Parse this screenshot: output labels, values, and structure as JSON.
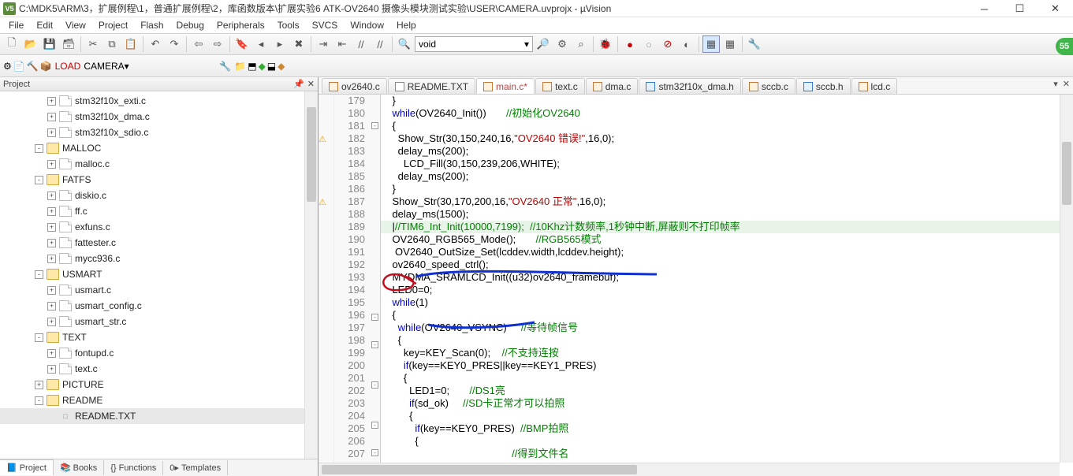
{
  "title": "C:\\MDK5\\ARM\\3，扩展例程\\1，普通扩展例程\\2，库函数版本\\扩展实验6 ATK-OV2640 摄像头模块测试实验\\USER\\CAMERA.uvprojx - µVision",
  "menu": [
    "File",
    "Edit",
    "View",
    "Project",
    "Flash",
    "Debug",
    "Peripherals",
    "Tools",
    "SVCS",
    "Window",
    "Help"
  ],
  "combo_void": "void",
  "target": "CAMERA",
  "project_header": "Project",
  "tree": [
    {
      "indent": 60,
      "exp": "+",
      "icon": "file",
      "label": "stm32f10x_exti.c"
    },
    {
      "indent": 60,
      "exp": "+",
      "icon": "file",
      "label": "stm32f10x_dma.c"
    },
    {
      "indent": 60,
      "exp": "+",
      "icon": "file",
      "label": "stm32f10x_sdio.c"
    },
    {
      "indent": 44,
      "exp": "-",
      "icon": "folder",
      "label": "MALLOC"
    },
    {
      "indent": 60,
      "exp": "+",
      "icon": "file",
      "label": "malloc.c"
    },
    {
      "indent": 44,
      "exp": "-",
      "icon": "folder",
      "label": "FATFS"
    },
    {
      "indent": 60,
      "exp": "+",
      "icon": "file",
      "label": "diskio.c"
    },
    {
      "indent": 60,
      "exp": "+",
      "icon": "file",
      "label": "ff.c"
    },
    {
      "indent": 60,
      "exp": "+",
      "icon": "file",
      "label": "exfuns.c"
    },
    {
      "indent": 60,
      "exp": "+",
      "icon": "file",
      "label": "fattester.c"
    },
    {
      "indent": 60,
      "exp": "+",
      "icon": "file",
      "label": "mycc936.c"
    },
    {
      "indent": 44,
      "exp": "-",
      "icon": "folder",
      "label": "USMART"
    },
    {
      "indent": 60,
      "exp": "+",
      "icon": "file",
      "label": "usmart.c"
    },
    {
      "indent": 60,
      "exp": "+",
      "icon": "file",
      "label": "usmart_config.c"
    },
    {
      "indent": 60,
      "exp": "+",
      "icon": "file",
      "label": "usmart_str.c"
    },
    {
      "indent": 44,
      "exp": "-",
      "icon": "folder",
      "label": "TEXT"
    },
    {
      "indent": 60,
      "exp": "+",
      "icon": "file",
      "label": "fontupd.c"
    },
    {
      "indent": 60,
      "exp": "+",
      "icon": "file",
      "label": "text.c"
    },
    {
      "indent": 44,
      "exp": "+",
      "icon": "folder",
      "label": "PICTURE"
    },
    {
      "indent": 44,
      "exp": "-",
      "icon": "folder",
      "label": "README"
    },
    {
      "indent": 60,
      "exp": " ",
      "icon": "txt",
      "label": "README.TXT",
      "sel": true
    }
  ],
  "projtabs": [
    {
      "icon": "📘",
      "label": "Project",
      "active": true
    },
    {
      "icon": "📚",
      "label": "Books"
    },
    {
      "icon": "{}",
      "label": "Functions"
    },
    {
      "icon": "0▸",
      "label": "Templates"
    }
  ],
  "tabs": [
    {
      "label": "ov2640.c",
      "ico": "r"
    },
    {
      "label": "README.TXT",
      "ico": "g"
    },
    {
      "label": "main.c*",
      "ico": "r",
      "active": true
    },
    {
      "label": "text.c",
      "ico": "r"
    },
    {
      "label": "dma.c",
      "ico": "r"
    },
    {
      "label": "stm32f10x_dma.h",
      "ico": "b"
    },
    {
      "label": "sccb.c",
      "ico": "r"
    },
    {
      "label": "sccb.h",
      "ico": "b"
    },
    {
      "label": "lcd.c",
      "ico": "r"
    }
  ],
  "code": [
    {
      "ln": 179,
      "fold": "",
      "mark": "",
      "html": "    }"
    },
    {
      "ln": 180,
      "fold": "",
      "mark": "",
      "html": "    <span class='kw'>while</span>(OV2640_Init())       <span class='cm'>//初始化OV2640</span>"
    },
    {
      "ln": 181,
      "fold": "-",
      "mark": "",
      "html": "    {"
    },
    {
      "ln": 182,
      "fold": "",
      "mark": "⚠",
      "html": "      Show_Str(30,150,240,16,<span class='str'>\"OV2640 错误!\"</span>,16,0);"
    },
    {
      "ln": 183,
      "fold": "",
      "mark": "",
      "html": "      delay_ms(200);"
    },
    {
      "ln": 184,
      "fold": "",
      "mark": "",
      "html": "        LCD_Fill(30,150,239,206,WHITE);"
    },
    {
      "ln": 185,
      "fold": "",
      "mark": "",
      "html": "      delay_ms(200);"
    },
    {
      "ln": 186,
      "fold": "",
      "mark": "",
      "html": "    }"
    },
    {
      "ln": 187,
      "fold": "",
      "mark": "⚠",
      "html": "    Show_Str(30,170,200,16,<span class='str'>\"OV2640 正常\"</span>,16,0);"
    },
    {
      "ln": 188,
      "fold": "",
      "mark": "",
      "html": "    delay_ms(1500);"
    },
    {
      "ln": 189,
      "fold": "",
      "mark": "",
      "hl": true,
      "html": "    |<span class='cm'>//TIM6_Int_Init(10000,7199);  //10Khz计数频率,1秒钟中断,屏蔽则不打印帧率</span>"
    },
    {
      "ln": 190,
      "fold": "",
      "mark": "",
      "html": "    OV2640_RGB565_Mode();       <span class='cm'>//RGB565模式</span>"
    },
    {
      "ln": 191,
      "fold": "",
      "mark": "",
      "html": "     OV2640_OutSize_Set(lcddev.width,lcddev.height);"
    },
    {
      "ln": 192,
      "fold": "",
      "mark": "",
      "html": "    ov2640_speed_ctrl();"
    },
    {
      "ln": 193,
      "fold": "",
      "mark": "",
      "html": "    MYDMA_SRAMLCD_Init((u32)ov2640_framebuf);"
    },
    {
      "ln": 194,
      "fold": "",
      "mark": "",
      "html": "    LED0=0;"
    },
    {
      "ln": 195,
      "fold": "",
      "mark": "",
      "html": "    <span class='kw'>while</span>(1)"
    },
    {
      "ln": 196,
      "fold": "-",
      "mark": "",
      "html": "    {"
    },
    {
      "ln": 197,
      "fold": "",
      "mark": "",
      "html": "      <span class='kw'>while</span>(OV2640_VSYNC)     <span class='cm'>//等待帧信号</span>"
    },
    {
      "ln": 198,
      "fold": "-",
      "mark": "",
      "html": "      {"
    },
    {
      "ln": 199,
      "fold": "",
      "mark": "",
      "html": "        key=KEY_Scan(0);    <span class='cm'>//不支持连按</span>"
    },
    {
      "ln": 200,
      "fold": "",
      "mark": "",
      "html": "        <span class='kw'>if</span>(key==KEY0_PRES||key==KEY1_PRES)"
    },
    {
      "ln": 201,
      "fold": "-",
      "mark": "",
      "html": "        {"
    },
    {
      "ln": 202,
      "fold": "",
      "mark": "",
      "html": "          LED1=0;       <span class='cm'>//DS1亮</span>"
    },
    {
      "ln": 203,
      "fold": "",
      "mark": "",
      "html": "          <span class='kw'>if</span>(sd_ok)     <span class='cm'>//SD卡正常才可以拍照</span>"
    },
    {
      "ln": 204,
      "fold": "-",
      "mark": "",
      "html": "          {"
    },
    {
      "ln": 205,
      "fold": "",
      "mark": "",
      "html": "            <span class='kw'>if</span>(key==KEY0_PRES)  <span class='cm'>//BMP拍照</span>"
    },
    {
      "ln": 206,
      "fold": "-",
      "mark": "",
      "html": "            {"
    },
    {
      "ln": 207,
      "fold": "",
      "mark": "",
      "html": "                                              <span class='cm'>//得到文件名</span>"
    }
  ],
  "badge": "55"
}
